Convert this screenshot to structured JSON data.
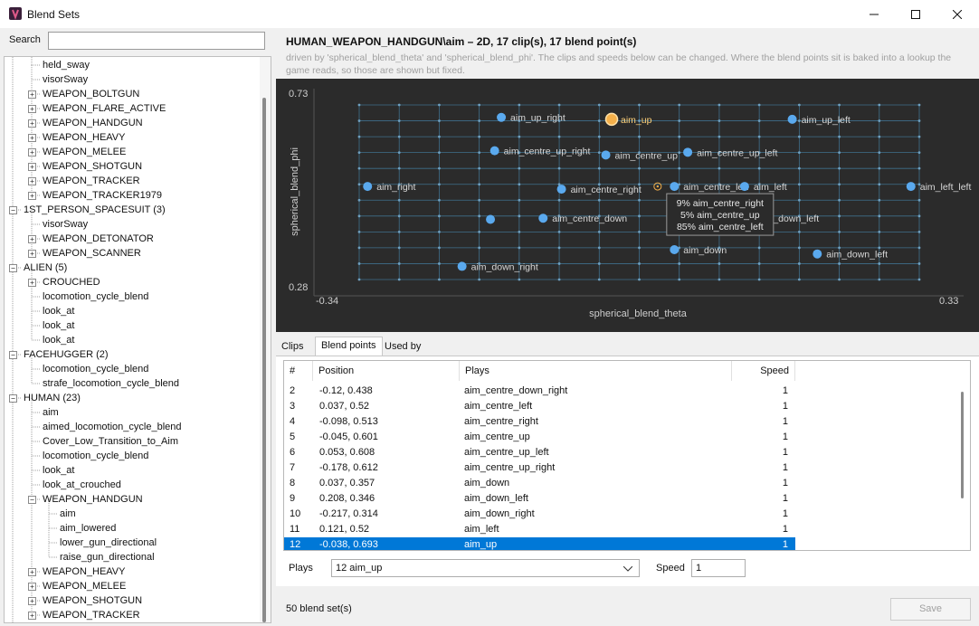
{
  "window": {
    "title": "Blend Sets",
    "minimize_icon": "minimize-icon",
    "maximize_icon": "maximize-icon",
    "close_icon": "close-icon"
  },
  "search": {
    "label": "Search",
    "value": ""
  },
  "tree": [
    {
      "label": "held_sway",
      "depth": 1,
      "expandable": false
    },
    {
      "label": "visorSway",
      "depth": 1,
      "expandable": false
    },
    {
      "label": "WEAPON_BOLTGUN",
      "depth": 1,
      "expandable": true,
      "expanded": false
    },
    {
      "label": "WEAPON_FLARE_ACTIVE",
      "depth": 1,
      "expandable": true,
      "expanded": false
    },
    {
      "label": "WEAPON_HANDGUN",
      "depth": 1,
      "expandable": true,
      "expanded": false
    },
    {
      "label": "WEAPON_HEAVY",
      "depth": 1,
      "expandable": true,
      "expanded": false
    },
    {
      "label": "WEAPON_MELEE",
      "depth": 1,
      "expandable": true,
      "expanded": false
    },
    {
      "label": "WEAPON_SHOTGUN",
      "depth": 1,
      "expandable": true,
      "expanded": false
    },
    {
      "label": "WEAPON_TRACKER",
      "depth": 1,
      "expandable": true,
      "expanded": false
    },
    {
      "label": "WEAPON_TRACKER1979",
      "depth": 1,
      "expandable": true,
      "expanded": false
    },
    {
      "label": "1ST_PERSON_SPACESUIT  (3)",
      "depth": 0,
      "expandable": true,
      "expanded": true
    },
    {
      "label": "visorSway",
      "depth": 1,
      "expandable": false
    },
    {
      "label": "WEAPON_DETONATOR",
      "depth": 1,
      "expandable": true,
      "expanded": false
    },
    {
      "label": "WEAPON_SCANNER",
      "depth": 1,
      "expandable": true,
      "expanded": false
    },
    {
      "label": "ALIEN  (5)",
      "depth": 0,
      "expandable": true,
      "expanded": true
    },
    {
      "label": "CROUCHED",
      "depth": 1,
      "expandable": true,
      "expanded": false
    },
    {
      "label": "locomotion_cycle_blend",
      "depth": 1,
      "expandable": false
    },
    {
      "label": "look_at",
      "depth": 1,
      "expandable": false
    },
    {
      "label": "look_at",
      "depth": 1,
      "expandable": false
    },
    {
      "label": "look_at",
      "depth": 1,
      "expandable": false
    },
    {
      "label": "FACEHUGGER  (2)",
      "depth": 0,
      "expandable": true,
      "expanded": true
    },
    {
      "label": "locomotion_cycle_blend",
      "depth": 1,
      "expandable": false
    },
    {
      "label": "strafe_locomotion_cycle_blend",
      "depth": 1,
      "expandable": false
    },
    {
      "label": "HUMAN  (23)",
      "depth": 0,
      "expandable": true,
      "expanded": true
    },
    {
      "label": "aim",
      "depth": 1,
      "expandable": false
    },
    {
      "label": "aimed_locomotion_cycle_blend",
      "depth": 1,
      "expandable": false
    },
    {
      "label": "Cover_Low_Transition_to_Aim",
      "depth": 1,
      "expandable": false
    },
    {
      "label": "locomotion_cycle_blend",
      "depth": 1,
      "expandable": false
    },
    {
      "label": "look_at",
      "depth": 1,
      "expandable": false
    },
    {
      "label": "look_at_crouched",
      "depth": 1,
      "expandable": false
    },
    {
      "label": "WEAPON_HANDGUN",
      "depth": 1,
      "expandable": true,
      "expanded": true
    },
    {
      "label": "aim",
      "depth": 2,
      "expandable": false
    },
    {
      "label": "aim_lowered",
      "depth": 2,
      "expandable": false
    },
    {
      "label": "lower_gun_directional",
      "depth": 2,
      "expandable": false
    },
    {
      "label": "raise_gun_directional",
      "depth": 2,
      "expandable": false
    },
    {
      "label": "WEAPON_HEAVY",
      "depth": 1,
      "expandable": true,
      "expanded": false
    },
    {
      "label": "WEAPON_MELEE",
      "depth": 1,
      "expandable": true,
      "expanded": false
    },
    {
      "label": "WEAPON_SHOTGUN",
      "depth": 1,
      "expandable": true,
      "expanded": false
    },
    {
      "label": "WEAPON_TRACKER",
      "depth": 1,
      "expandable": true,
      "expanded": false
    }
  ],
  "header": {
    "title": "HUMAN_WEAPON_HANDGUN\\aim   –   2D, 17 clip(s), 17 blend point(s)",
    "description": "driven by 'spherical_blend_theta' and 'spherical_blend_phi'.  The clips and speeds below can be changed. Where the blend points sit is baked into a lookup the game reads, so those are shown but fixed."
  },
  "chart_data": {
    "type": "scatter",
    "xlabel": "spherical_blend_theta",
    "ylabel": "spherical_blend_phi",
    "xlim": [
      -0.34,
      0.33
    ],
    "ylim": [
      0.28,
      0.73
    ],
    "x_tick_labels": [
      "-0.34",
      "0.33"
    ],
    "y_tick_labels": [
      "0.73",
      "0.28"
    ],
    "grid": true,
    "points": [
      {
        "label": "aim_up_right",
        "x": -0.17,
        "y": 0.698,
        "selected": false
      },
      {
        "label": "aim_up",
        "x": -0.038,
        "y": 0.693,
        "selected": true
      },
      {
        "label": "aim_up_left",
        "x": 0.178,
        "y": 0.693,
        "selected": false
      },
      {
        "label": "aim_centre_up_right",
        "x": -0.178,
        "y": 0.612,
        "selected": false
      },
      {
        "label": "aim_centre_up",
        "x": -0.045,
        "y": 0.601,
        "selected": false
      },
      {
        "label": "aim_centre_up_left",
        "x": 0.053,
        "y": 0.608,
        "selected": false
      },
      {
        "label": "aim_right",
        "x": -0.33,
        "y": 0.52,
        "selected": false
      },
      {
        "label": "aim_centre_right",
        "x": -0.098,
        "y": 0.513,
        "selected": false
      },
      {
        "label": "aim_centre_left",
        "x": 0.037,
        "y": 0.52,
        "selected": false
      },
      {
        "label": "aim_left",
        "x": 0.121,
        "y": 0.52,
        "selected": false
      },
      {
        "label": "aim_left_left",
        "x": 0.32,
        "y": 0.52,
        "selected": false
      },
      {
        "label": "",
        "x": -0.183,
        "y": 0.435,
        "selected": false
      },
      {
        "label": "aim_centre_down",
        "x": -0.12,
        "y": 0.438,
        "selected": false
      },
      {
        "label": "aim_centre_down_left",
        "x": 0.088,
        "y": 0.438,
        "selected": false
      },
      {
        "label": "aim_down",
        "x": 0.037,
        "y": 0.357,
        "selected": false
      },
      {
        "label": "aim_down_left",
        "x": 0.208,
        "y": 0.346,
        "selected": false
      },
      {
        "label": "aim_down_right",
        "x": -0.217,
        "y": 0.314,
        "selected": false
      }
    ],
    "probe": {
      "x": 0.017,
      "y": 0.52
    },
    "tooltip": [
      "9%  aim_centre_right",
      "5%  aim_centre_up",
      "85%  aim_centre_left"
    ]
  },
  "tabs": [
    {
      "label": "Clips",
      "active": false
    },
    {
      "label": "Blend points",
      "active": true
    },
    {
      "label": "Used by",
      "active": false
    }
  ],
  "grid": {
    "columns": [
      "#",
      "Position",
      "Plays",
      "Speed"
    ],
    "rows": [
      {
        "n": "2",
        "position": "-0.12, 0.438",
        "plays": "aim_centre_down_right",
        "speed": "1",
        "selected": false
      },
      {
        "n": "3",
        "position": "0.037, 0.52",
        "plays": "aim_centre_left",
        "speed": "1",
        "selected": false
      },
      {
        "n": "4",
        "position": "-0.098, 0.513",
        "plays": "aim_centre_right",
        "speed": "1",
        "selected": false
      },
      {
        "n": "5",
        "position": "-0.045, 0.601",
        "plays": "aim_centre_up",
        "speed": "1",
        "selected": false
      },
      {
        "n": "6",
        "position": "0.053, 0.608",
        "plays": "aim_centre_up_left",
        "speed": "1",
        "selected": false
      },
      {
        "n": "7",
        "position": "-0.178, 0.612",
        "plays": "aim_centre_up_right",
        "speed": "1",
        "selected": false
      },
      {
        "n": "8",
        "position": "0.037, 0.357",
        "plays": "aim_down",
        "speed": "1",
        "selected": false
      },
      {
        "n": "9",
        "position": "0.208, 0.346",
        "plays": "aim_down_left",
        "speed": "1",
        "selected": false
      },
      {
        "n": "10",
        "position": "-0.217, 0.314",
        "plays": "aim_down_right",
        "speed": "1",
        "selected": false
      },
      {
        "n": "11",
        "position": "0.121, 0.52",
        "plays": "aim_left",
        "speed": "1",
        "selected": false
      },
      {
        "n": "12",
        "position": "-0.038, 0.693",
        "plays": "aim_up",
        "speed": "1",
        "selected": true
      }
    ]
  },
  "editor": {
    "plays_label": "Plays",
    "plays_value": "12  aim_up",
    "speed_label": "Speed",
    "speed_value": "1"
  },
  "status": "50 blend set(s)",
  "save_label": "Save",
  "colors": {
    "selection": "#0078d7",
    "point": "#5aa9ee",
    "selected_point": "#f5b04a",
    "plot_bg": "#2b2b2b",
    "grid": "#3f6f8c"
  }
}
